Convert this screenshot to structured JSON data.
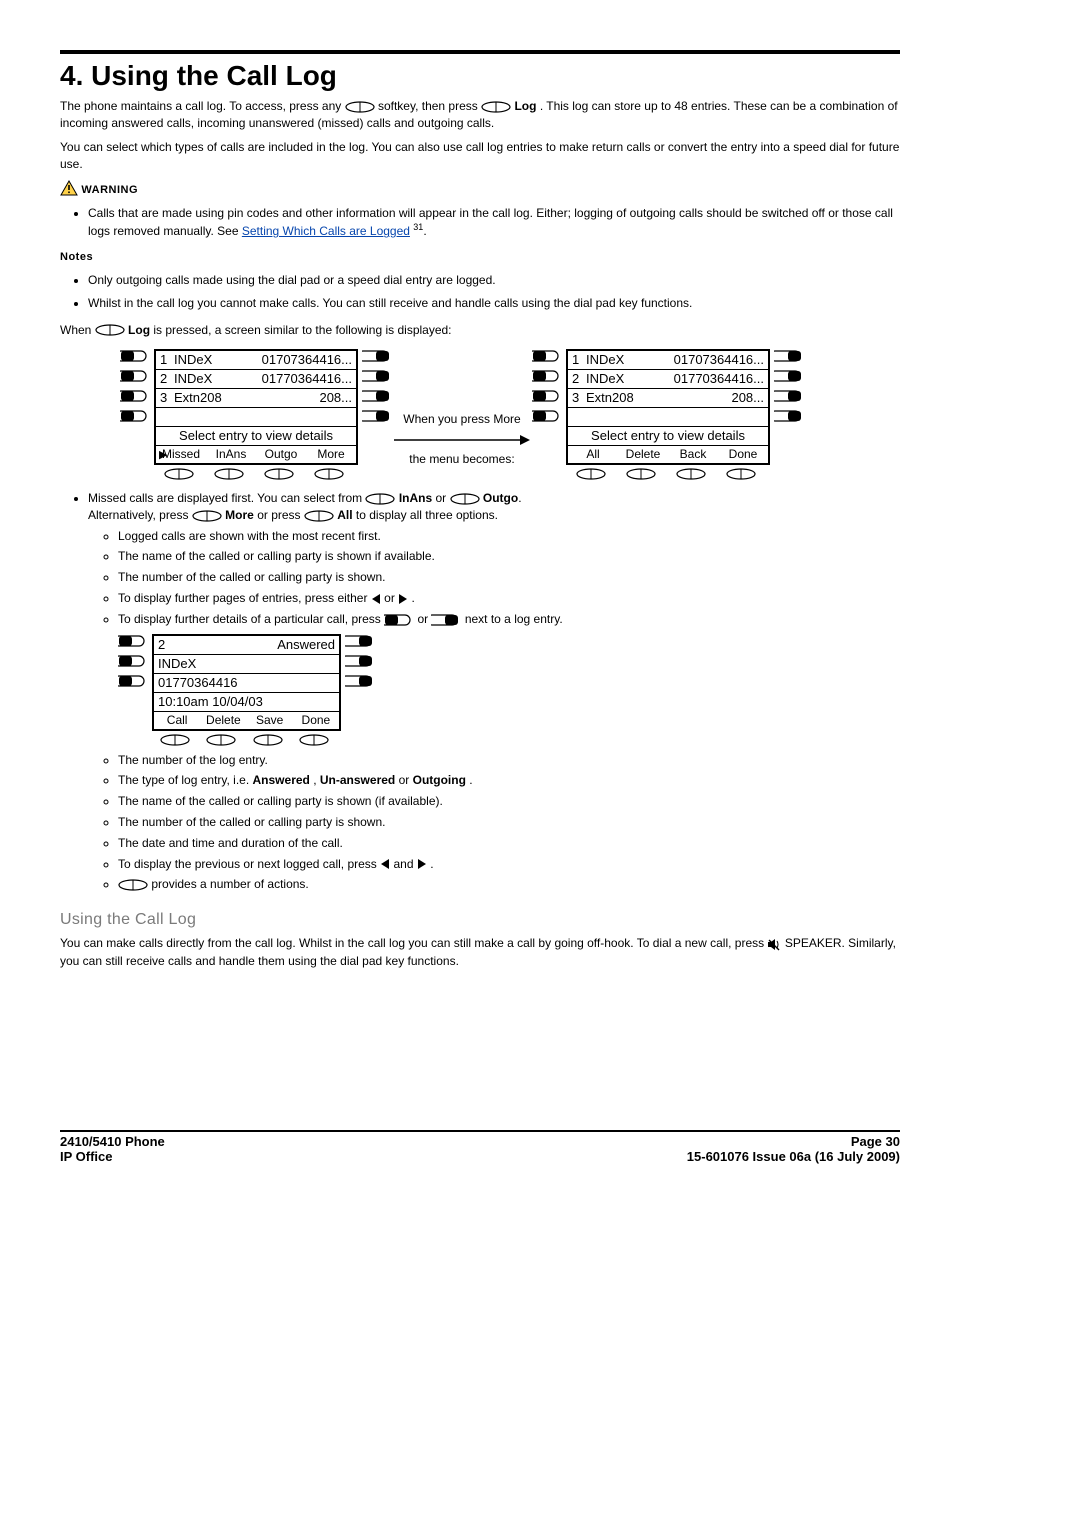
{
  "heading": "4. Using the Call Log",
  "intro1a": "The phone maintains a call log. To access, press any ",
  "intro1b": " softkey, then press ",
  "intro1c": " Log",
  "intro1d": ". This log can store up to 48 entries. These can be a combination of incoming answered calls, incoming unanswered (missed) calls and outgoing calls.",
  "intro2": "You can select which types of calls are included in the log. You can also use call log entries to make return calls or convert the entry into a speed dial for future use.",
  "warn_label": "WARNING",
  "warn_text_a": "Calls that are made using pin codes and other information will appear in the call log. Either; logging of outgoing calls should be switched off or those call logs removed manually. See ",
  "warn_link": "Setting Which Calls are Logged",
  "warn_ref": "31",
  "notes_label": "Notes",
  "note1": "Only outgoing calls made using the dial pad or a speed dial entry are logged.",
  "note2": "Whilst in the call log you cannot make calls. You can still receive and handle calls using the dial pad key functions.",
  "when_a": "When ",
  "when_b": " Log",
  "when_c": " is pressed, a screen similar to the following is displayed:",
  "screenA": {
    "rows": [
      {
        "n": "1",
        "name": "INDeX",
        "num": "01707364416..."
      },
      {
        "n": "2",
        "name": "INDeX",
        "num": "01770364416..."
      },
      {
        "n": "3",
        "name": "Extn208",
        "num": "208..."
      }
    ],
    "label": "Select entry to view details",
    "soft": [
      "Missed",
      "InAns",
      "Outgo",
      "More"
    ]
  },
  "mid1": "When you press More",
  "mid2": "the menu becomes:",
  "screenB": {
    "rows": [
      {
        "n": "1",
        "name": "INDeX",
        "num": "01707364416..."
      },
      {
        "n": "2",
        "name": "INDeX",
        "num": "01770364416..."
      },
      {
        "n": "3",
        "name": "Extn208",
        "num": "208..."
      }
    ],
    "label": "Select entry to view details",
    "soft": [
      "All",
      "Delete",
      "Back",
      "Done"
    ]
  },
  "b1a": "Missed calls are displayed first. You can select from ",
  "b1b": " InAns",
  "b1c": " or ",
  "b1d": " Outgo",
  "b1e": ".",
  "b1f_a": "Alternatively, press ",
  "b1f_b": " More",
  "b1f_c": " or press ",
  "b1f_d": " All",
  "b1f_e": " to display all three options.",
  "sub1": "Logged calls are shown with the most recent first.",
  "sub2": "The name of the called or calling party is shown if available.",
  "sub3": "The number of the called or calling party is shown.",
  "sub4a": "To display further pages of entries, press either ",
  "sub4b": " or ",
  "sub4c": ".",
  "sub5a": "To display further details of a particular call, press ",
  "sub5b": " or ",
  "sub5c": " next to a log entry.",
  "screenC": {
    "rows": [
      {
        "left": "2",
        "right": "Answered"
      },
      {
        "left": "INDeX",
        "right": ""
      },
      {
        "left": "01770364416",
        "right": ""
      },
      {
        "left": "10:10am  10/04/03",
        "right": ""
      }
    ],
    "soft": [
      "Call",
      "Delete",
      "Save",
      "Done"
    ]
  },
  "d1": "The number of the log entry.",
  "d2a": "The type of log entry, i.e. ",
  "d2b": "Answered",
  "d2c": ", ",
  "d2d": "Un-answered",
  "d2e": " or ",
  "d2f": "Outgoing",
  "d2g": ".",
  "d3": "The name of the called or calling party is shown (if available).",
  "d4": "The number of the called or calling party is shown.",
  "d5": "The date and time and duration of the call.",
  "d6a": "To display the previous or next logged call, press ",
  "d6b": " and ",
  "d6c": ".",
  "d7a": " provides a number of actions.",
  "subhead": "Using the Call Log",
  "uc1a": "You can make calls directly from the call log. Whilst in the call log you can still make a call by going off-hook. To dial a new call, press ",
  "uc1b": " SPEAKER. Similarly, you can still receive calls and handle them using the dial pad key functions.",
  "footer": {
    "l1": "2410/5410 Phone",
    "l2": "IP Office",
    "r1": "Page 30",
    "r2": "15-601076 Issue 06a (16 July 2009)"
  }
}
